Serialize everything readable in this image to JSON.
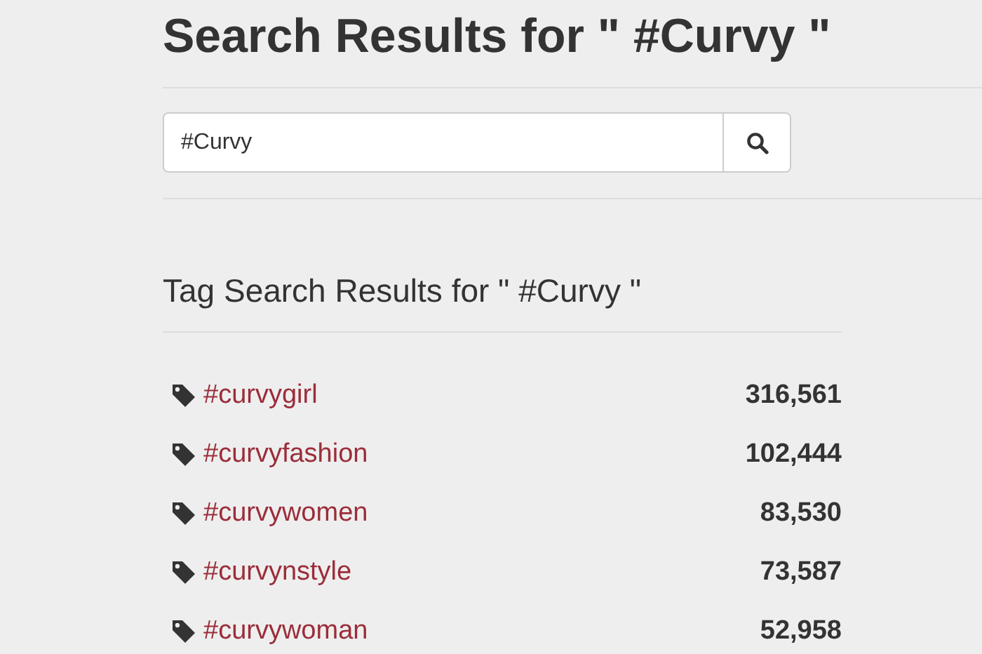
{
  "title": "Search Results for \" #Curvy \"",
  "search": {
    "value": "#Curvy"
  },
  "section_title": "Tag Search Results for \" #Curvy \"",
  "tags": [
    {
      "name": "#curvygirl",
      "count": "316,561"
    },
    {
      "name": "#curvyfashion",
      "count": "102,444"
    },
    {
      "name": "#curvywomen",
      "count": "83,530"
    },
    {
      "name": "#curvynstyle",
      "count": "73,587"
    },
    {
      "name": "#curvywoman",
      "count": "52,958"
    }
  ]
}
